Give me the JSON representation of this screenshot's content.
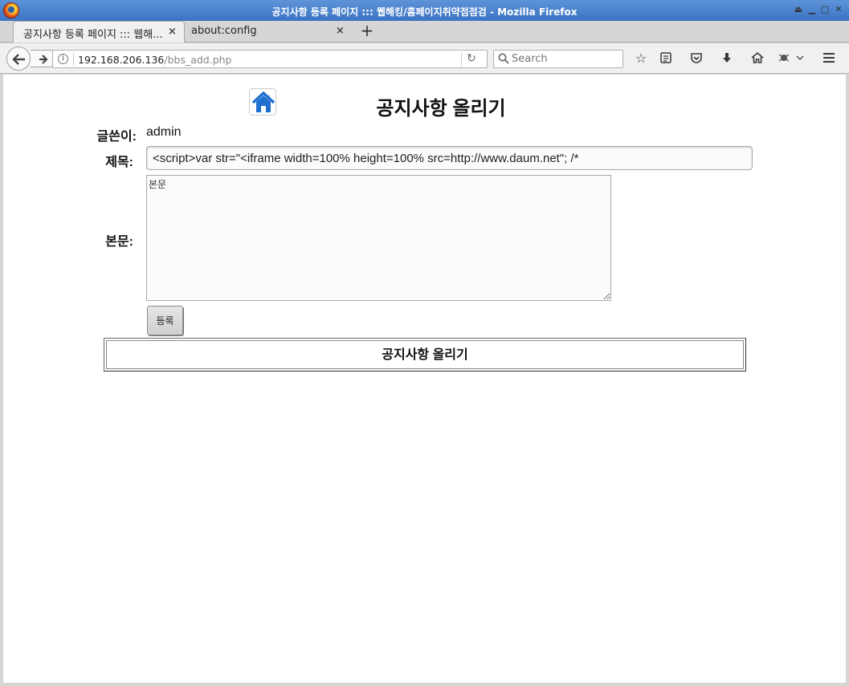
{
  "window": {
    "title": "공지사항 등록 페이지 ::: 웹해킹/홈페이지취약점점검 - Mozilla Firefox"
  },
  "tabs": [
    {
      "label": "공지사항 등록 페이지 ::: 웹해...",
      "active": true
    },
    {
      "label": "about:config",
      "active": false
    }
  ],
  "navbar": {
    "url_host": "192.168.206.136",
    "url_path": "/bbs_add.php",
    "search_placeholder": "Search"
  },
  "page": {
    "title": "공지사항 올리기",
    "author_label": "글쓴이:",
    "author_value": "admin",
    "subject_label": "제목:",
    "subject_value": "<script>var str=\"<iframe width=100% height=100% src=http://www.daum.net\"; /*",
    "body_label": "본문:",
    "body_value": "본문",
    "submit_label": "등록",
    "footer_title": "공지사항 올리기"
  },
  "colors": {
    "titlebar": "#3b74c4",
    "home_icon": "#1f6fcf"
  }
}
